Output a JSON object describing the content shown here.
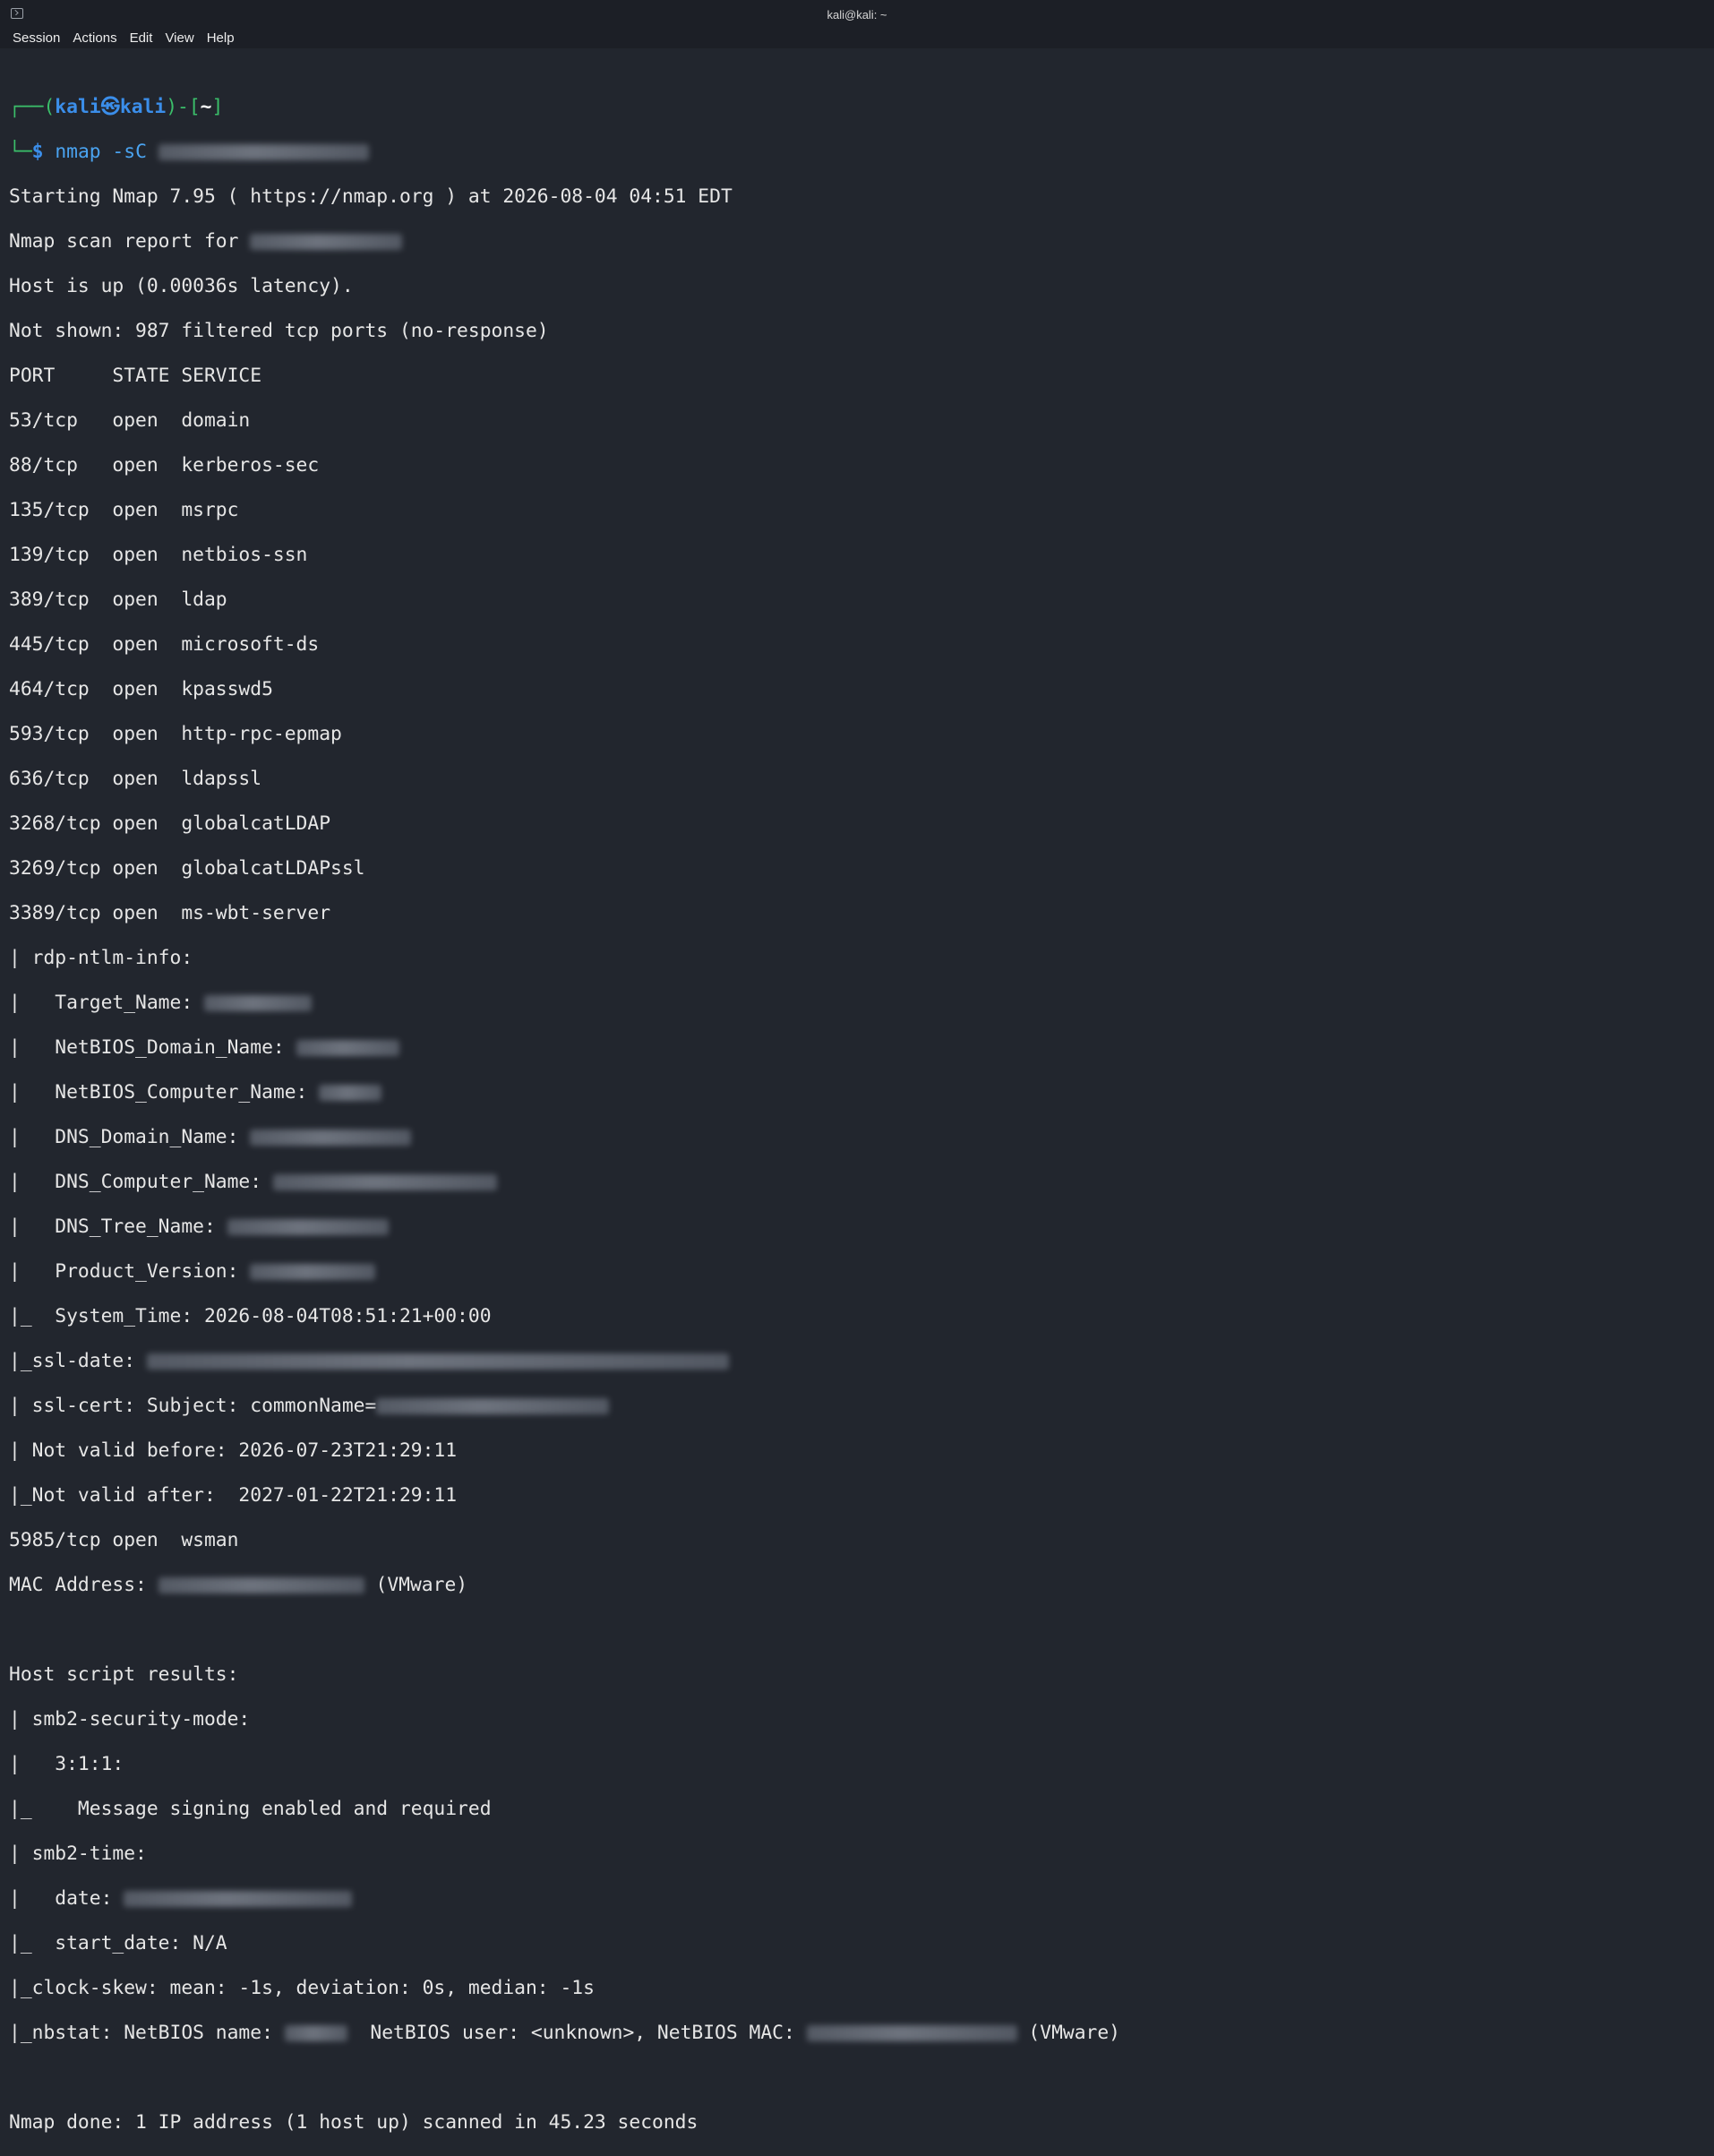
{
  "window": {
    "title": "kali@kali: ~"
  },
  "menu": [
    "Session",
    "Actions",
    "Edit",
    "View",
    "Help"
  ],
  "prompt": {
    "open": "┌──(",
    "user": "kali",
    "at": "㉿",
    "host": "kali",
    "mid": ")-[",
    "dir": "~",
    "close": "]",
    "line2": "└─",
    "dollar": "$ ",
    "command": "nmap -sC "
  },
  "output": {
    "l01": "Starting Nmap 7.95 ( https://nmap.org ) at 2026-08-04 04:51 EDT",
    "l02": "Nmap scan report for ",
    "l03": "Host is up (0.00036s latency).",
    "l04": "Not shown: 987 filtered tcp ports (no-response)",
    "l05": "PORT     STATE SERVICE",
    "l06": "53/tcp   open  domain",
    "l07": "88/tcp   open  kerberos-sec",
    "l08": "135/tcp  open  msrpc",
    "l09": "139/tcp  open  netbios-ssn",
    "l10": "389/tcp  open  ldap",
    "l11": "445/tcp  open  microsoft-ds",
    "l12": "464/tcp  open  kpasswd5",
    "l13": "593/tcp  open  http-rpc-epmap",
    "l14": "636/tcp  open  ldapssl",
    "l15": "3268/tcp open  globalcatLDAP",
    "l16": "3269/tcp open  globalcatLDAPssl",
    "l17": "3389/tcp open  ms-wbt-server",
    "l18": "| rdp-ntlm-info: ",
    "l19": "|   Target_Name: ",
    "l20": "|   NetBIOS_Domain_Name: ",
    "l21": "|   NetBIOS_Computer_Name: ",
    "l22": "|   DNS_Domain_Name: ",
    "l23": "|   DNS_Computer_Name: ",
    "l24": "|   DNS_Tree_Name: ",
    "l25": "|   Product_Version: ",
    "l26": "|_  System_Time: 2026-08-04T08:51:21+00:00",
    "l27": "|_ssl-date: ",
    "l28": "| ssl-cert: Subject: commonName=",
    "l29": "| Not valid before: 2026-07-23T21:29:11",
    "l30": "|_Not valid after:  2027-01-22T21:29:11",
    "l31": "5985/tcp open  wsman",
    "l32a": "MAC Address: ",
    "l32b": " (VMware)",
    "l34": "Host script results:",
    "l35": "| smb2-security-mode: ",
    "l36": "|   3:1:1: ",
    "l37": "|_    Message signing enabled and required",
    "l38": "| smb2-time: ",
    "l39": "|   date: ",
    "l40": "|_  start_date: N/A",
    "l41": "|_clock-skew: mean: -1s, deviation: 0s, median: -1s",
    "l42a": "|_nbstat: NetBIOS name: ",
    "l42b": "  NetBIOS user: <unknown>, NetBIOS MAC: ",
    "l42c": " (VMware)",
    "l44": "Nmap done: 1 IP address (1 host up) scanned in 45.23 seconds"
  }
}
